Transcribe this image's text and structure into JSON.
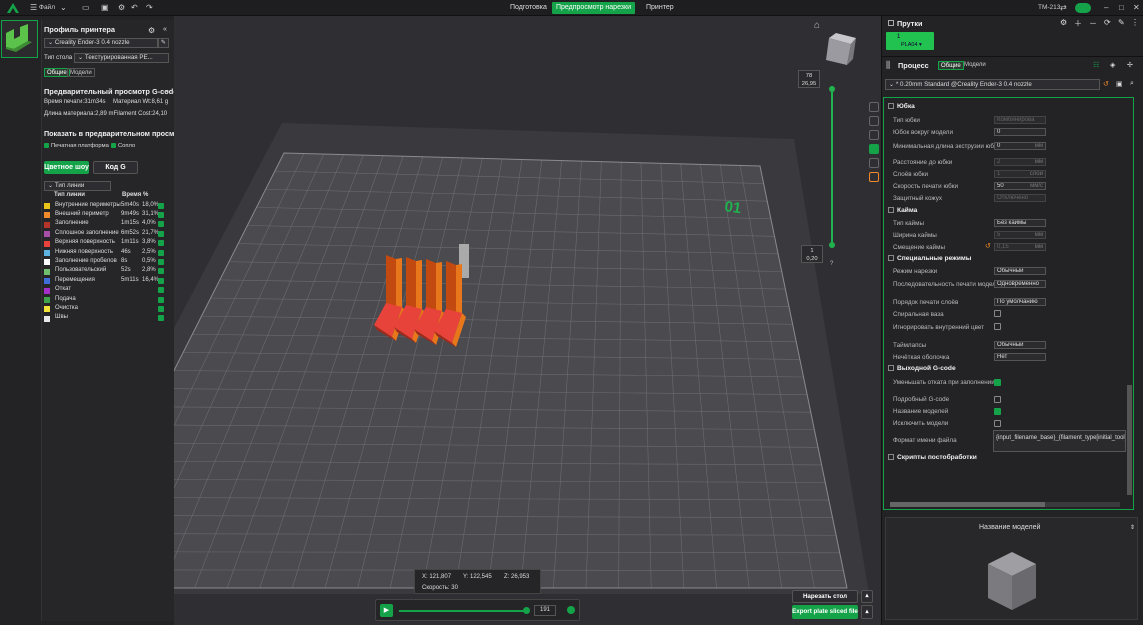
{
  "topbar": {
    "menu_label": "Файл",
    "tabs": [
      "Подготовка",
      "Предпросмотр нарезки",
      "Принтер"
    ],
    "active_tab": 1,
    "user": "TM-213"
  },
  "printer_panel": {
    "title": "Профиль принтера",
    "printer": "Creality Ender-3 0.4 nozzle",
    "bed_label": "Тип стола",
    "bed_value": "Текстурированная PE...",
    "tabs": [
      "Общие",
      "Модели"
    ]
  },
  "gcode_preview": {
    "title": "Предварительный просмотр G-code",
    "line1_left": "Время печати:31m34s",
    "line1_right": "Материал Wt:8,61 g",
    "line2": "Длина материала:2,89 mFilament Cost:24,10",
    "show_title": "Показать в предварительном просмо",
    "check1": "Печатная платформа",
    "check2": "Сопло",
    "color_button": "Цветное шоу",
    "code_button": "Код G",
    "line_type_select": "Тип линии",
    "columns": [
      "Тип линии",
      "Время",
      "%"
    ],
    "rows": [
      {
        "name": "Внутренние периметры",
        "time": "5m40s",
        "pct": "18,0%",
        "color": "#e8c31a"
      },
      {
        "name": "Внешний периметр",
        "time": "9m49s",
        "pct": "31,1%",
        "color": "#f08a2a"
      },
      {
        "name": "Заполнение",
        "time": "1m15s",
        "pct": "4,0%",
        "color": "#b5342c"
      },
      {
        "name": "Сплошное заполнение",
        "time": "6m52s",
        "pct": "21,7%",
        "color": "#a54fa8"
      },
      {
        "name": "Верхняя поверхность",
        "time": "1m11s",
        "pct": "3,8%",
        "color": "#e8433a"
      },
      {
        "name": "Нижняя поверхность",
        "time": "46s",
        "pct": "2,5%",
        "color": "#5cb2e0"
      },
      {
        "name": "Заполнение пробелов",
        "time": "8s",
        "pct": "0,5%",
        "color": "#ffffff"
      },
      {
        "name": "Пользовательский",
        "time": "52s",
        "pct": "2,8%",
        "color": "#6fbf6f"
      },
      {
        "name": "Перемещения",
        "time": "5m11s",
        "pct": "16,4%",
        "color": "#3f6fd8"
      },
      {
        "name": "Откат",
        "time": "",
        "pct": "",
        "color": "#a52ec8"
      },
      {
        "name": "Подача",
        "time": "",
        "pct": "",
        "color": "#3fa34a"
      },
      {
        "name": "Очистка",
        "time": "",
        "pct": "",
        "color": "#f2e43a"
      },
      {
        "name": "Швы",
        "time": "",
        "pct": "",
        "color": "#e8e8e8"
      }
    ]
  },
  "viewport": {
    "plate_label": "01",
    "layer_top": "78",
    "layer_top_h": "26,95",
    "layer_bottom": "1",
    "layer_bottom_h": "0,20",
    "coords": {
      "x": "X: 121,807",
      "y": "Y: 122,545",
      "z": "Z: 26,953"
    },
    "speed": "Скорость: 30",
    "play_value": "191",
    "slice_plate": "Нарезать стол",
    "export_button": "Export plate sliced file"
  },
  "right_panel": {
    "printer_header": "Прутки",
    "filament_num": "1",
    "filament_name": "PLA04 ▾",
    "process_header": "Процесс",
    "process_tabs": [
      "Общие",
      "Модели"
    ],
    "process_preset": "* 0.20mm Standard @Creality Ender-3 0.4 nozzle",
    "sections": {
      "skirt": "Юбка",
      "brim": "Кайма",
      "special": "Специальные режимы",
      "gcode_out": "Выходной G-code",
      "scripts": "Скрипты постобработки"
    },
    "skirt_fields": [
      {
        "label": "Тип юбки",
        "value": "Комбинирова"
      },
      {
        "label": "Юбок вокруг модели",
        "value": "0"
      },
      {
        "label": "Минимальная длина экструзии юбки",
        "value": "0"
      },
      {
        "label": "Расстояние до юбки",
        "value": "2"
      },
      {
        "label": "Слоёв юбки",
        "value": "1"
      },
      {
        "label": "Скорость печати юбки",
        "value": "50"
      },
      {
        "label": "Защитный кожух",
        "value": "Отключено"
      }
    ],
    "units": {
      "mm": "мм",
      "layers": "слой",
      "speed": "мм/с"
    },
    "brim_fields": [
      {
        "label": "Тип каймы",
        "value": "Без каймы"
      },
      {
        "label": "Ширина каймы",
        "value": "5"
      },
      {
        "label": "Смещение каймы",
        "value": "0,15"
      }
    ],
    "special_fields": [
      {
        "label": "Режим нарезки",
        "value": "Обычный"
      },
      {
        "label": "Последовательность печати моделей",
        "value": "Одновременно"
      },
      {
        "label": "Порядок печати слоёв",
        "value": "По умолчанию"
      },
      {
        "label": "Спиральная ваза",
        "value": ""
      },
      {
        "label": "Игнорировать внутренний цвет",
        "value": ""
      },
      {
        "label": "Таймлапсы",
        "value": "Обычный"
      },
      {
        "label": "Нечёткая оболочка",
        "value": "Нет"
      }
    ],
    "gcode_fields": [
      {
        "label": "Уменьшать отката при заполнении",
        "checked": true
      },
      {
        "label": "Подробный G-code",
        "checked": false
      },
      {
        "label": "Название моделей",
        "checked": true
      },
      {
        "label": "Исключить модели",
        "checked": false
      },
      {
        "label": "Формат имени файла",
        "value": "{input_filename_base}_{filament_type[initial_tool]}_{prin"
      }
    ],
    "bottom_title": "Название моделей"
  }
}
